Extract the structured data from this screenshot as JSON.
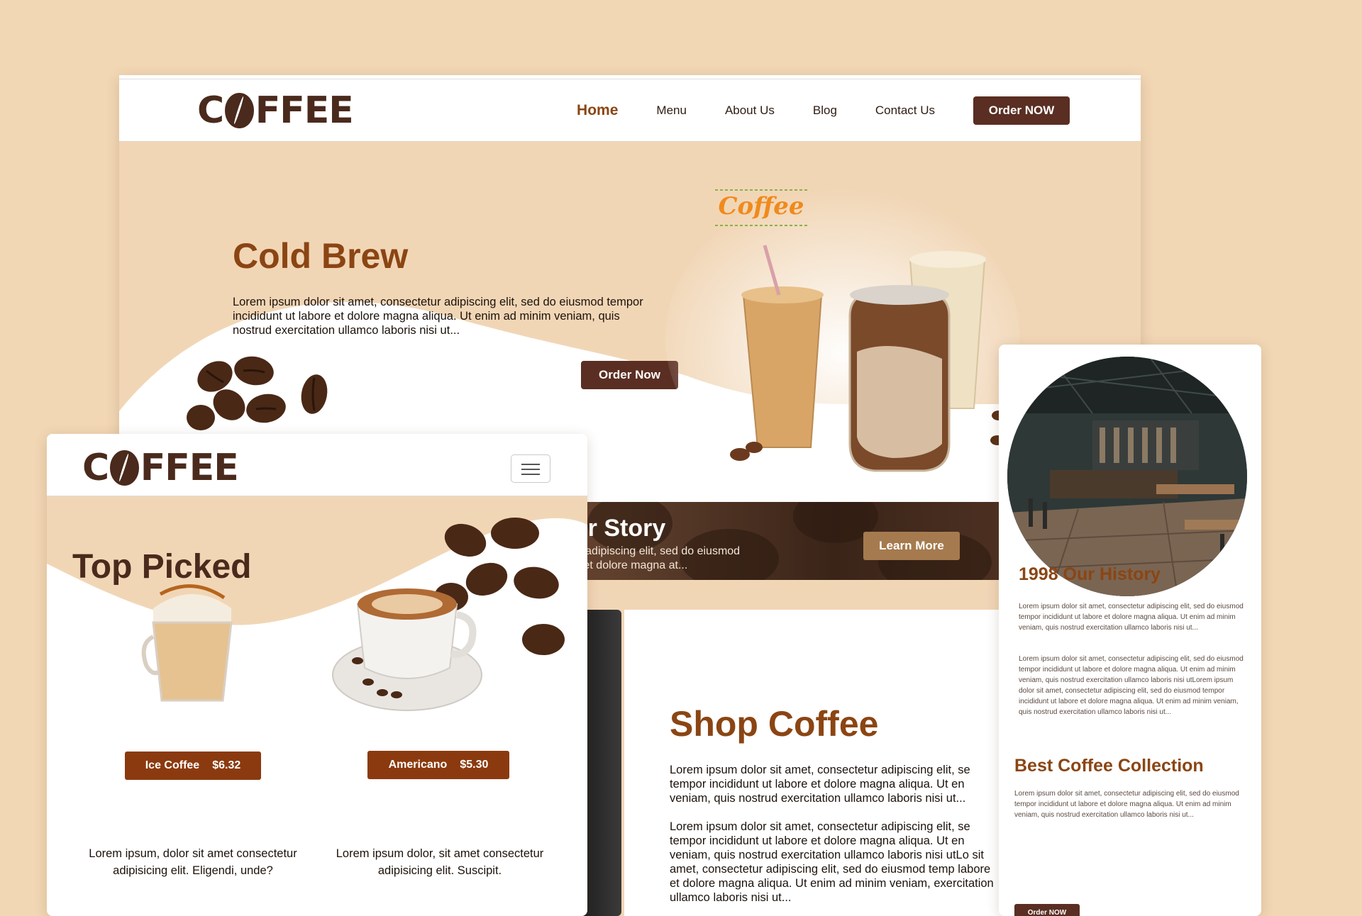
{
  "colors": {
    "background": "#f2d7b5",
    "accent_brown": "#8b4513",
    "dark_button": "#5a2e22",
    "price_button": "#8b3a0f",
    "learn_more": "#a57a4e"
  },
  "desktop": {
    "logo": "COFFEE",
    "nav": [
      "Home",
      "Menu",
      "About Us",
      "Blog",
      "Contact Us"
    ],
    "order_button": "Order NOW",
    "hero": {
      "title": "Cold Brew",
      "text": "Lorem ipsum dolor sit amet, consectetur adipiscing elit, sed do eiusmod tempor incididunt ut labore et dolore magna aliqua. Ut enim ad minim veniam, quis nostrud exercitation ullamco laboris nisi ut...",
      "button": "Order Now",
      "badge": "Coffee"
    },
    "story": {
      "title": "rn Our Story",
      "text": "consectetur adipiscing elit, sed do eiusmod\nnt ut labore et dolore magna at...",
      "button": "Learn More"
    },
    "shop": {
      "title": "Shop Coffee",
      "para1": "Lorem ipsum dolor sit amet, consectetur adipiscing elit, se tempor incididunt ut labore et dolore magna aliqua. Ut en veniam, quis nostrud exercitation ullamco laboris nisi ut...",
      "para2": "Lorem ipsum dolor sit amet, consectetur adipiscing elit, se tempor incididunt ut labore et dolore magna aliqua. Ut en veniam, quis nostrud exercitation ullamco laboris nisi utLo sit amet, consectetur adipiscing elit, sed do eiusmod temp labore et dolore magna aliqua. Ut enim ad minim veniam, exercitation ullamco laboris nisi ut..."
    }
  },
  "history": {
    "title": "1998 Our History",
    "para1": "Lorem ipsum dolor sit amet, consectetur adipiscing elit, sed do eiusmod tempor incididunt ut labore et dolore magna aliqua. Ut enim ad minim veniam, quis nostrud exercitation ullamco laboris nisi ut...",
    "para2": "Lorem ipsum dolor sit amet, consectetur adipiscing elit, sed do eiusmod tempor incididunt ut labore et dolore magna aliqua. Ut enim ad minim veniam, quis nostrud exercitation ullamco laboris nisi utLorem ipsum dolor sit amet, consectetur adipiscing elit, sed do eiusmod tempor incididunt ut labore et dolore magna aliqua. Ut enim ad minim veniam, quis nostrud exercitation ullamco laboris nisi ut...",
    "collection_title": "Best Coffee Collection",
    "para3": "Lorem ipsum dolor sit amet, consectetur adipiscing elit, sed do eiusmod tempor incididunt ut labore et dolore magna aliqua. Ut enim ad minim veniam, quis nostrud exercitation ullamco laboris nisi ut...",
    "button": "Order NOW"
  },
  "picked": {
    "logo": "COFFEE",
    "title": "Top Picked",
    "products": [
      {
        "name": "Ice Coffee",
        "price": "$6.32",
        "desc": "Lorem ipsum, dolor sit amet consectetur adipisicing elit. Eligendi, unde?"
      },
      {
        "name": "Americano",
        "price": "$5.30",
        "desc": "Lorem ipsum dolor, sit amet consectetur adipisicing elit. Suscipit."
      }
    ]
  }
}
